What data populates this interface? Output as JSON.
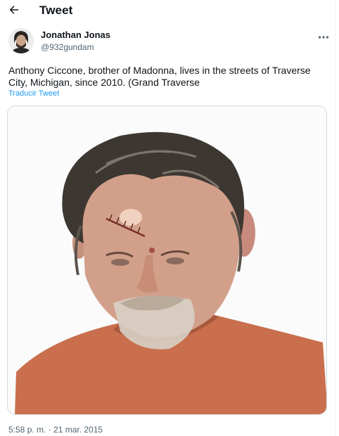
{
  "header": {
    "back_icon": "arrow-left-icon",
    "title": "Tweet"
  },
  "author": {
    "display_name": "Jonathan Jonas",
    "handle": "@932gundam",
    "more_icon": "more-horizontal-icon"
  },
  "tweet": {
    "text": "Anthony Ciccone, brother of Madonna, lives in the streets of Traverse City, Michigan, since 2010. (Grand Traverse",
    "translate_label": "Traducir Tweet",
    "timestamp": "5:58 p. m. · 21 mar. 2015"
  },
  "colors": {
    "accent": "#1d9bf0",
    "text_primary": "#0f1419",
    "text_secondary": "#536471",
    "border": "#cfd9de"
  }
}
